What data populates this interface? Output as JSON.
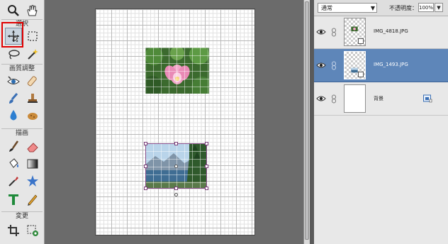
{
  "toolbox": {
    "section_select": "選択",
    "section_enhance": "画質調整",
    "section_draw": "描画",
    "section_modify": "変更",
    "tools": [
      "zoom-tool",
      "hand-tool",
      "move-tool",
      "marquee-tool",
      "lasso-tool",
      "magic-wand-tool",
      "red-eye-tool",
      "spot-healing-tool",
      "smart-brush-tool",
      "clone-stamp-tool",
      "blur-tool",
      "sponge-tool",
      "brush-tool",
      "eraser-tool",
      "paint-bucket-tool",
      "gradient-tool",
      "eyedropper-tool",
      "custom-shape-tool",
      "type-tool",
      "pencil-tool",
      "crop-tool",
      "recompose-tool"
    ]
  },
  "layers_panel": {
    "blend_mode": "通常",
    "opacity_label": "不透明度：",
    "opacity_value": "100%",
    "layers": [
      {
        "name": "IMG_4818.JPG",
        "selected": false
      },
      {
        "name": "IMG_1493.JPG",
        "selected": true
      },
      {
        "name": "背景",
        "selected": false
      }
    ]
  },
  "colors": {
    "selection_highlight": "#e00000",
    "selected_layer": "#5e86b9",
    "canvas_bg": "#6b6b6b"
  }
}
